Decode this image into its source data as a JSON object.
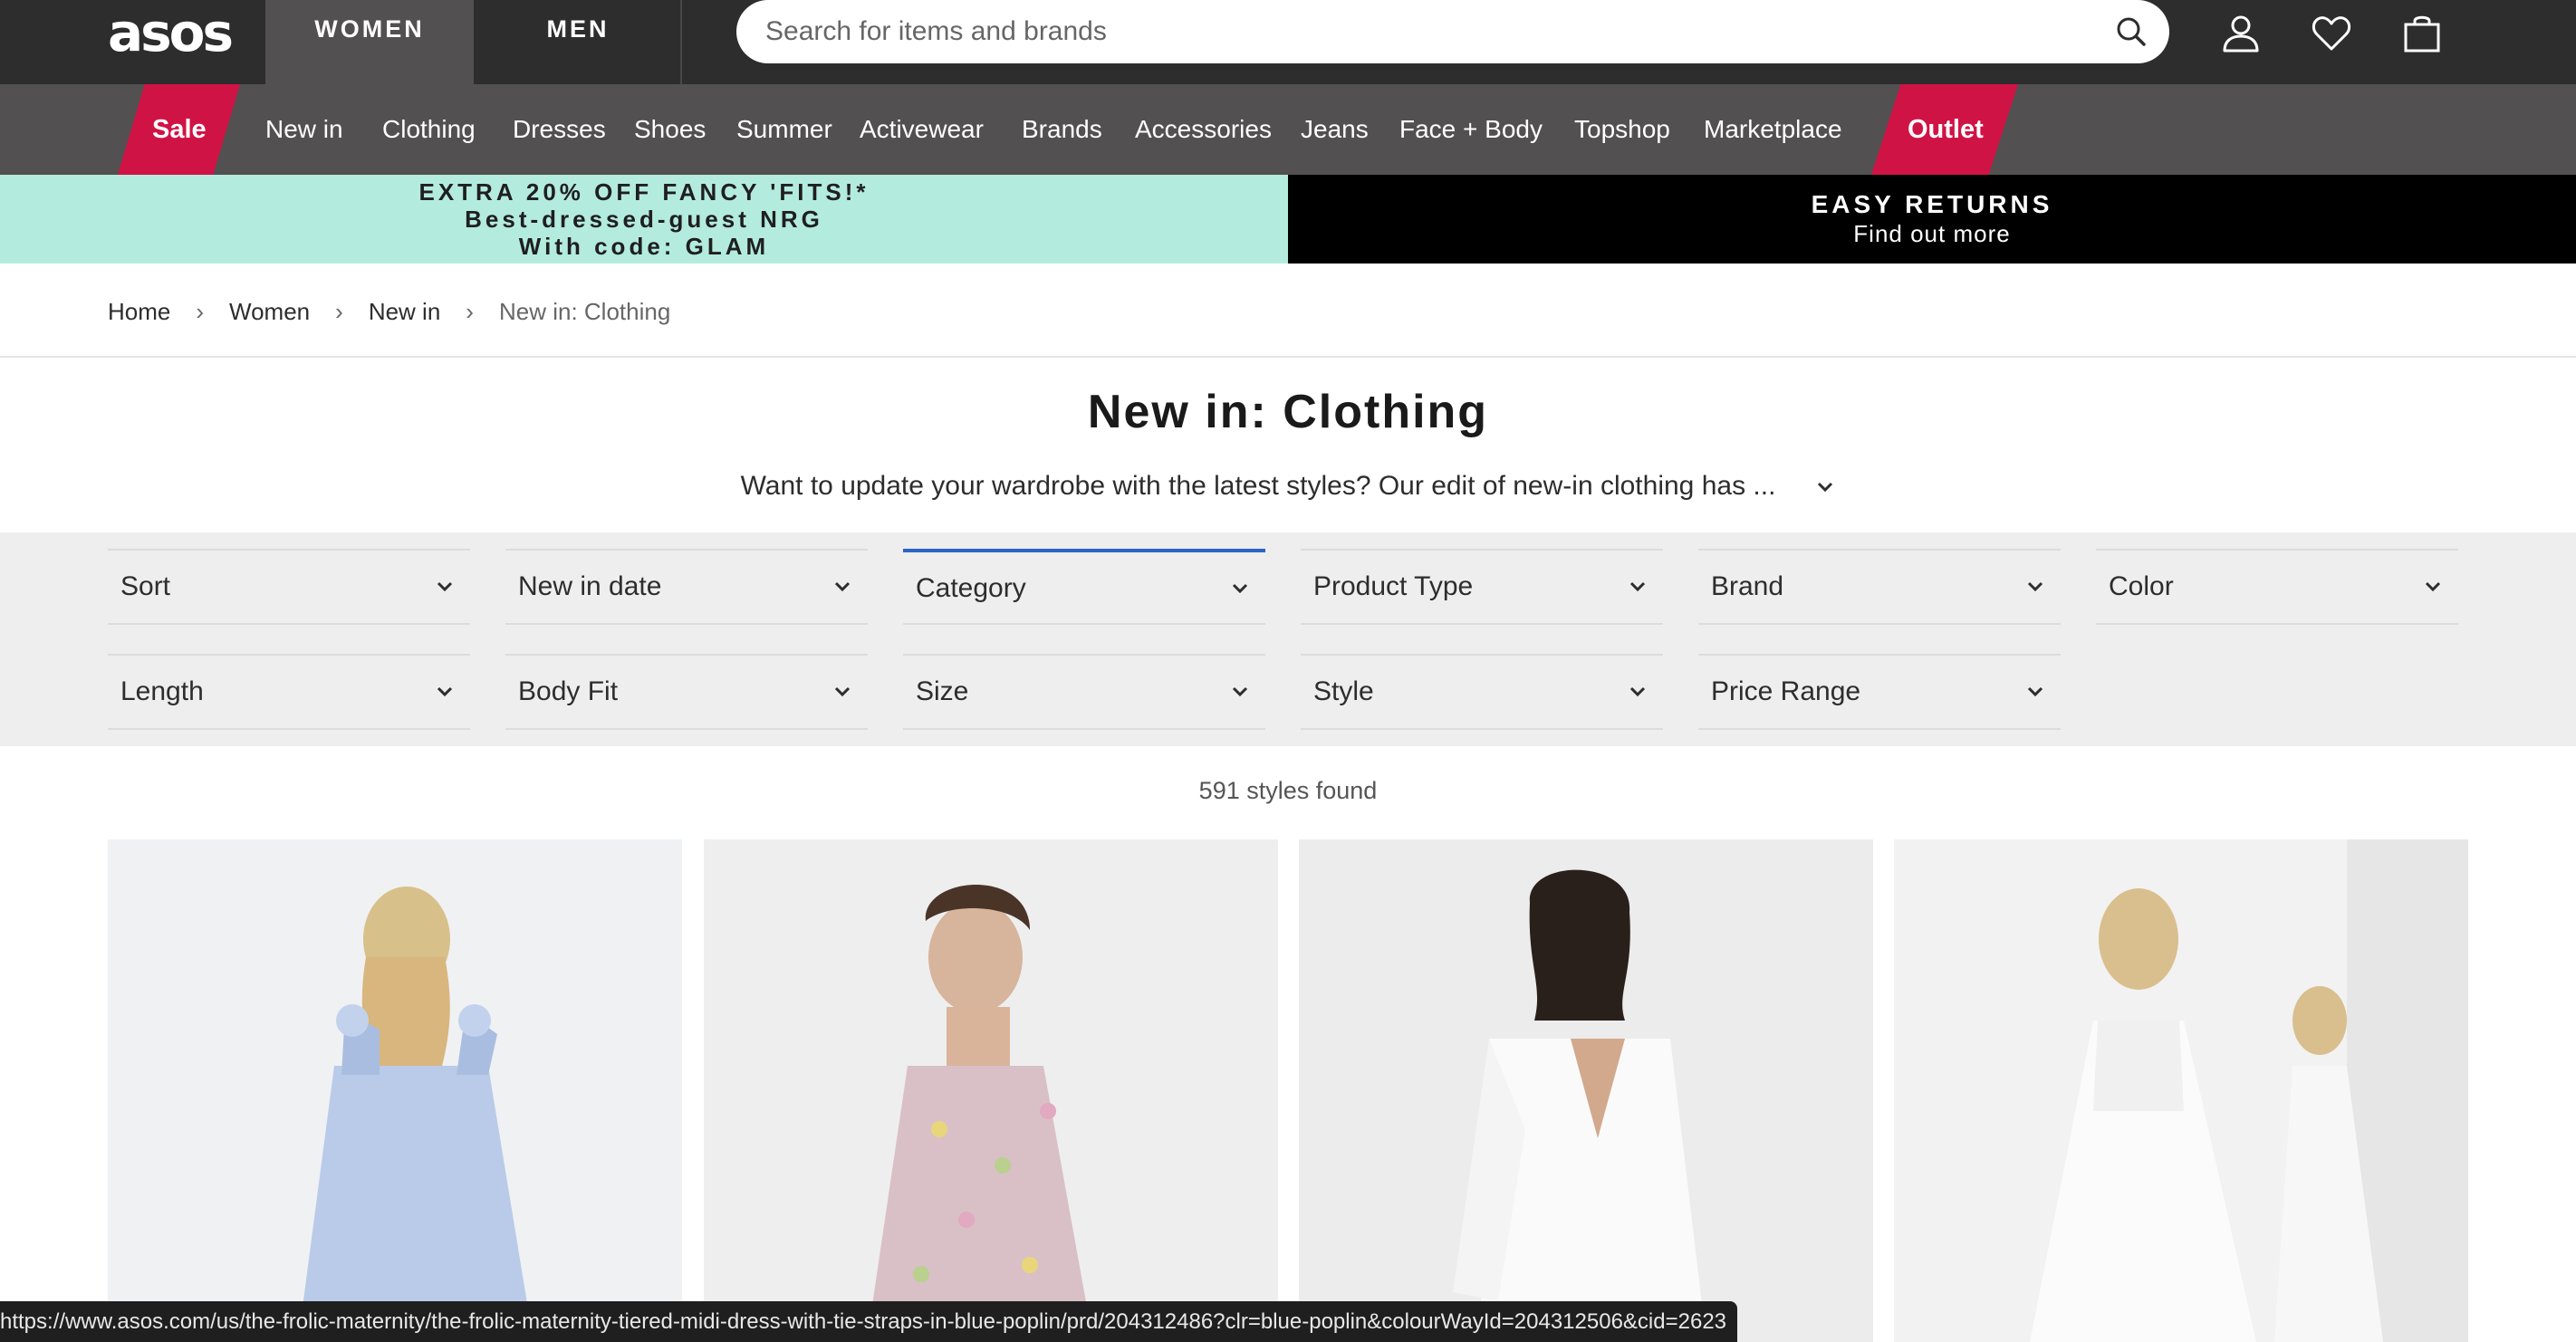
{
  "brand": {
    "logo_text": "asos"
  },
  "header": {
    "tabs": [
      {
        "label": "WOMEN"
      },
      {
        "label": "MEN"
      }
    ],
    "search_placeholder": "Search for items and brands",
    "icons": [
      "search-icon",
      "account-icon",
      "heart-icon",
      "bag-icon"
    ]
  },
  "nav": {
    "sale": "Sale",
    "items": [
      "New in",
      "Clothing",
      "Dresses",
      "Shoes",
      "Summer",
      "Activewear",
      "Brands",
      "Accessories",
      "Jeans",
      "Face + Body",
      "Topshop",
      "Marketplace"
    ],
    "outlet": "Outlet",
    "accent_color": "#d01345"
  },
  "promo": {
    "left": {
      "line1": "EXTRA 20% OFF FANCY 'FITS!*",
      "line2": "Best-dressed-guest NRG",
      "line3": "With code: GLAM",
      "bg": "#b4ebdf"
    },
    "right": {
      "title": "EASY RETURNS",
      "link": "Find out more"
    }
  },
  "breadcrumb": [
    "Home",
    "Women",
    "New in",
    "New in: Clothing"
  ],
  "page": {
    "title": "New in: Clothing",
    "description": "Want to update your wardrobe with the latest styles? Our edit of new-in clothing has ...",
    "results_count": "591 styles found"
  },
  "filters": {
    "row1": [
      "Sort",
      "New in date",
      "Category",
      "Product Type",
      "Brand",
      "Color"
    ],
    "row2": [
      "Length",
      "Body Fit",
      "Size",
      "Style",
      "Price Range"
    ],
    "active": "Category"
  },
  "products": [
    {
      "image": "blue-poplin-tiered-midi-dress"
    },
    {
      "image": "floral-mini-dress"
    },
    {
      "image": "white-blazer-dress"
    },
    {
      "image": "white-corset-lace-midi-dress"
    }
  ],
  "status_bar": {
    "url": "https://www.asos.com/us/the-frolic-maternity/the-frolic-maternity-tiered-midi-dress-with-tie-straps-in-blue-poplin/prd/204312486?clr=blue-poplin&colourWayId=204312506&cid=2623"
  }
}
